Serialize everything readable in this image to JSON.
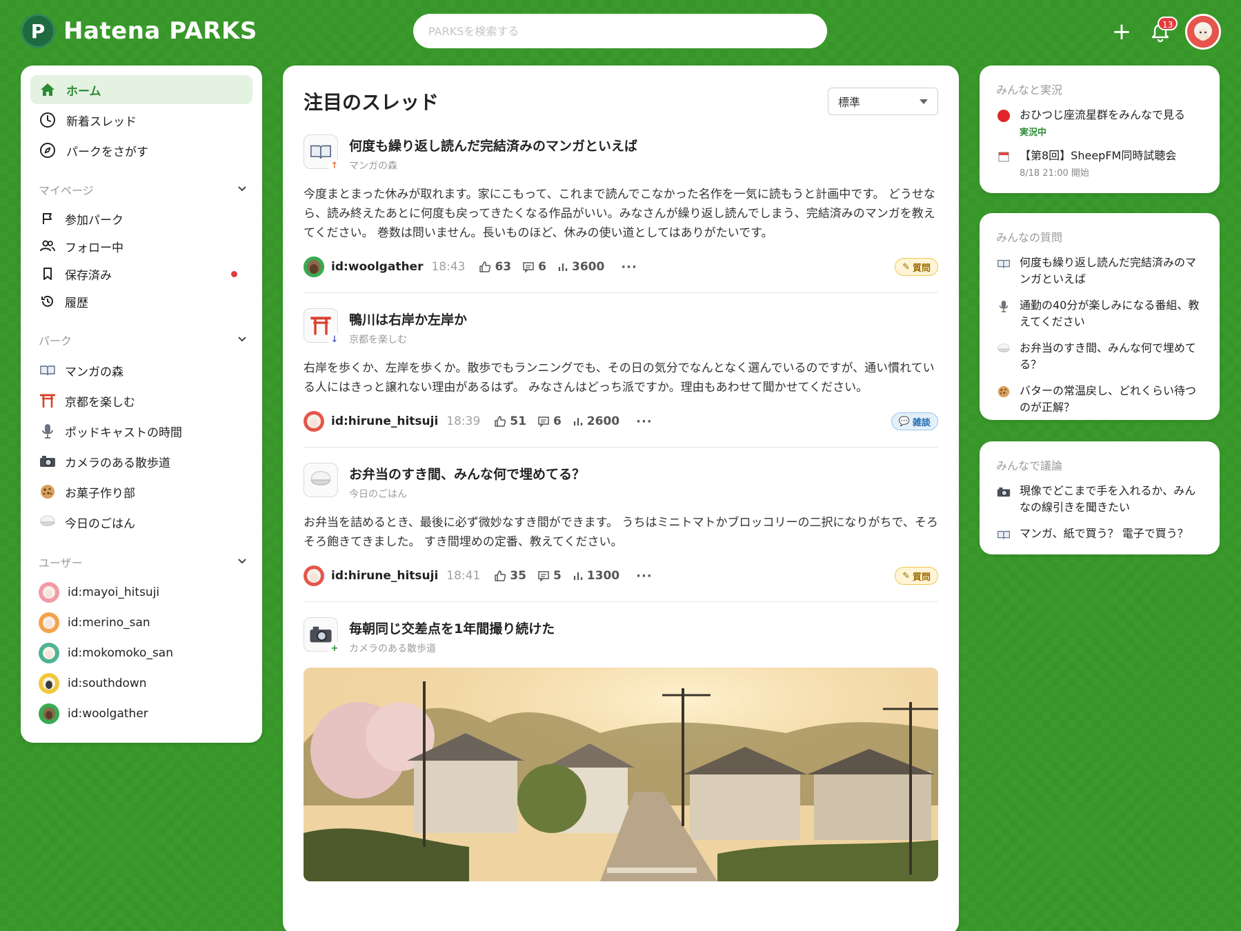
{
  "app": {
    "name": "Hatena PARKS",
    "logo_glyph": "P",
    "search_placeholder": "PARKSを検索する",
    "notification_count": "13",
    "accent": "#2a8b33",
    "background": "#3a9a2c"
  },
  "sidebar": {
    "nav": [
      {
        "label": "ホーム",
        "icon": "home-icon"
      },
      {
        "label": "新着スレッド",
        "icon": "clock-icon"
      },
      {
        "label": "パークをさがす",
        "icon": "compass-icon"
      }
    ],
    "mypage": {
      "title": "マイページ",
      "items": [
        {
          "label": "参加パーク",
          "icon": "flag-icon"
        },
        {
          "label": "フォロー中",
          "icon": "people-icon"
        },
        {
          "label": "保存済み",
          "icon": "bookmark-icon"
        },
        {
          "label": "履歴",
          "icon": "history-icon"
        }
      ]
    },
    "parks": {
      "title": "パーク",
      "items": [
        {
          "label": "マンガの森",
          "icon": "book-icon"
        },
        {
          "label": "京都を楽しむ",
          "icon": "torii-icon"
        },
        {
          "label": "ポッドキャストの時間",
          "icon": "microphone-icon"
        },
        {
          "label": "カメラのある散歩道",
          "icon": "camera-icon"
        },
        {
          "label": "お菓子作り部",
          "icon": "cookie-icon"
        },
        {
          "label": "今日のごはん",
          "icon": "rice-bowl-icon"
        }
      ]
    },
    "users": {
      "title": "ユーザー",
      "items": [
        {
          "label": "id:mayoi_hitsuji",
          "color": "#f39aa6"
        },
        {
          "label": "id:merino_san",
          "color": "#f4a24a"
        },
        {
          "label": "id:mokomoko_san",
          "color": "#4fb391"
        },
        {
          "label": "id:southdown",
          "color": "#f3c73a"
        },
        {
          "label": "id:woolgather",
          "color": "#3aaa52"
        }
      ]
    }
  },
  "main": {
    "title": "注目のスレッド",
    "sort_value": "標準",
    "threads": [
      {
        "title": "何度も繰り返し読んだ完結済みのマンガといえば",
        "park": "マンガの森",
        "body": "今度まとまった休みが取れます。家にこもって、これまで読んでこなかった名作を一気に読もうと計画中です。 どうせなら、読み終えたあとに何度も戻ってきたくなる作品がいい。みなさんが繰り返し読んでしまう、完結済みのマンガを教えてください。 巻数は問いません。長いものほど、休みの使い道としてはありがたいです。",
        "user": "id:woolgather",
        "time": "18:43",
        "likes": "63",
        "comments": "6",
        "views": "3600",
        "tag": "質問",
        "more": "···"
      },
      {
        "title": "鴨川は右岸か左岸か",
        "park": "京都を楽しむ",
        "body": "右岸を歩くか、左岸を歩くか。散歩でもランニングでも、その日の気分でなんとなく選んでいるのですが、通い慣れている人にはきっと譲れない理由があるはず。 みなさんはどっち派ですか。理由もあわせて聞かせてください。",
        "user": "id:hirune_hitsuji",
        "time": "18:39",
        "likes": "51",
        "comments": "6",
        "views": "2600",
        "tag": "雑談",
        "more": "···"
      },
      {
        "title": "お弁当のすき間、みんな何で埋めてる？",
        "park": "今日のごはん",
        "body": "お弁当を詰めるとき、最後に必ず微妙なすき間ができます。 うちはミニトマトかブロッコリーの二択になりがちで、そろそろ飽きてきました。 すき間埋めの定番、教えてください。",
        "user": "id:hirune_hitsuji",
        "time": "18:41",
        "likes": "35",
        "comments": "5",
        "views": "1300",
        "tag": "質問",
        "more": "···"
      },
      {
        "title": "毎朝同じ交差点を1年間撮り続けた",
        "park": "カメラのある散歩道"
      }
    ]
  },
  "right": {
    "live": {
      "title": "みんなと実況",
      "items": [
        {
          "text": "おひつじ座流星群をみんなで見る",
          "sub": "実況中",
          "icon": "live-dot-icon"
        },
        {
          "text": "【第8回】SheepFM同時試聴会",
          "sub": "8/18 21:00 開始",
          "icon": "calendar-icon"
        }
      ]
    },
    "questions": {
      "title": "みんなの質問",
      "items": [
        {
          "text": "何度も繰り返し読んだ完結済みのマンガといえば",
          "icon": "book-icon"
        },
        {
          "text": "通勤の40分が楽しみになる番組、教えてください",
          "icon": "microphone-icon"
        },
        {
          "text": "お弁当のすき間、みんな何で埋めてる？",
          "icon": "rice-bowl-icon"
        },
        {
          "text": "バターの常温戻し、どれくらい待つのが正解？",
          "icon": "cookie-icon"
        }
      ]
    },
    "discussion": {
      "title": "みんなで議論",
      "items": [
        {
          "text": "現像でどこまで手を入れるか、みんなの線引きを聞きたい",
          "icon": "camera-icon"
        },
        {
          "text": "マンガ、紙で買う？ 電子で買う？",
          "icon": "book-icon"
        }
      ]
    }
  }
}
